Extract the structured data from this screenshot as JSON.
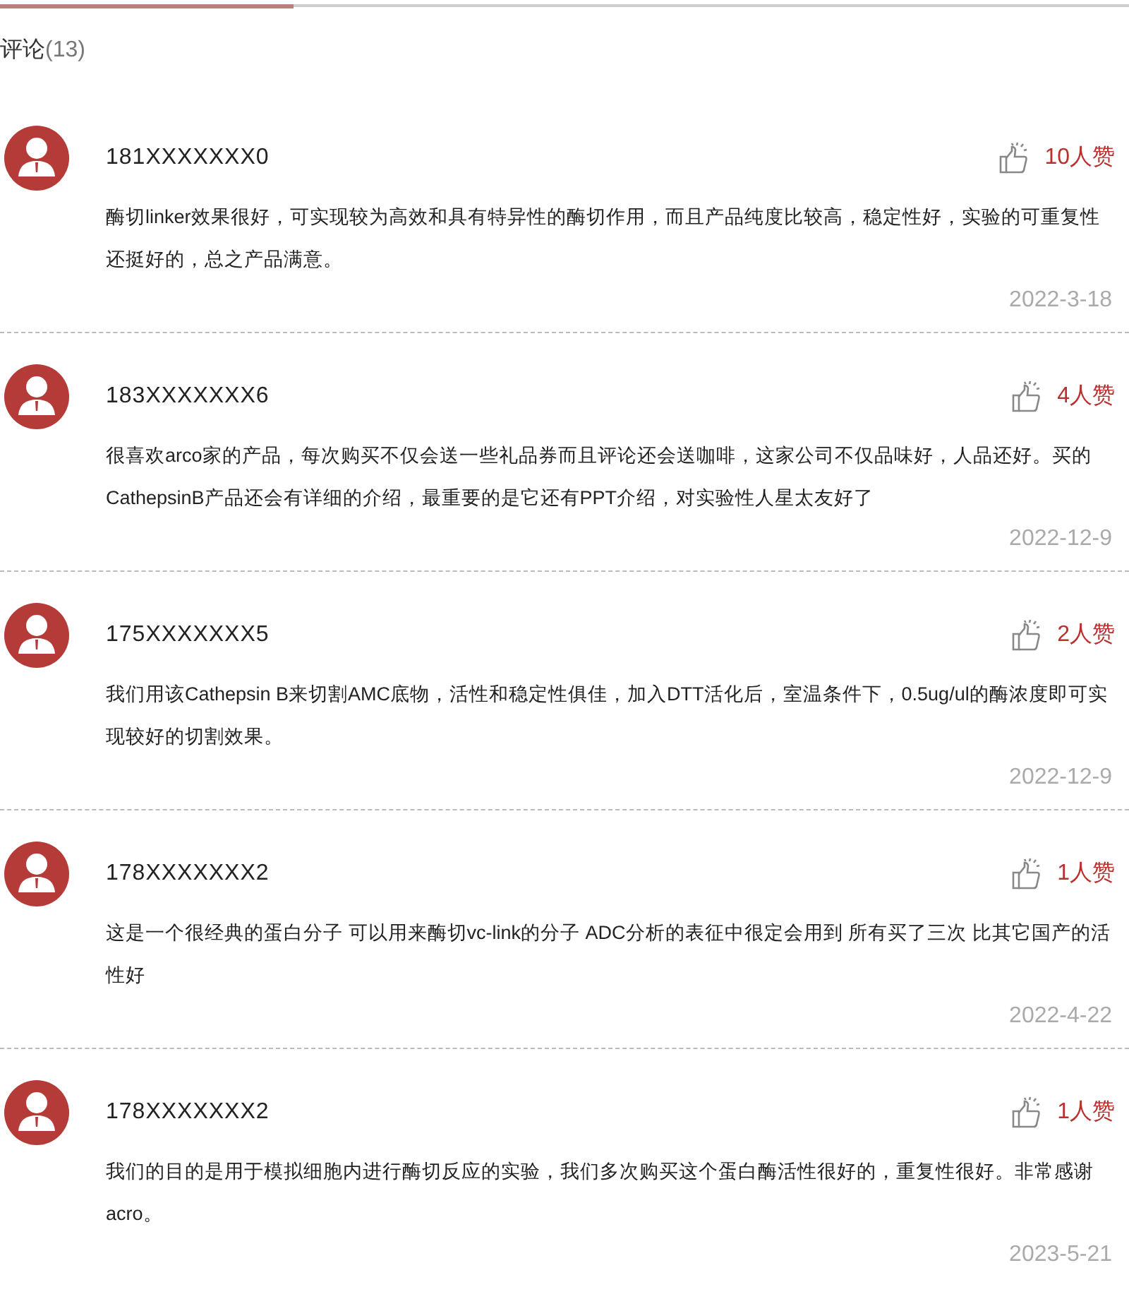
{
  "section_title": {
    "label": "评论",
    "count": "(13)"
  },
  "comments": [
    {
      "user": "181XXXXXXX0",
      "likes": "10人赞",
      "text": "酶切linker效果很好，可实现较为高效和具有特异性的酶切作用，而且产品纯度比较高，稳定性好，实验的可重复性还挺好的，总之产品满意。",
      "date": "2022-3-18"
    },
    {
      "user": "183XXXXXXX6",
      "likes": "4人赞",
      "text": "很喜欢arco家的产品，每次购买不仅会送一些礼品券而且评论还会送咖啡，这家公司不仅品味好，人品还好。买的CathepsinB产品还会有详细的介绍，最重要的是它还有PPT介绍，对实验性人星太友好了",
      "date": "2022-12-9"
    },
    {
      "user": "175XXXXXXX5",
      "likes": "2人赞",
      "text": "我们用该Cathepsin B来切割AMC底物，活性和稳定性俱佳，加入DTT活化后，室温条件下，0.5ug/ul的酶浓度即可实现较好的切割效果。",
      "date": "2022-12-9"
    },
    {
      "user": "178XXXXXXX2",
      "likes": "1人赞",
      "text": "这是一个很经典的蛋白分子 可以用来酶切vc-link的分子 ADC分析的表征中很定会用到 所有买了三次 比其它国产的活性好",
      "date": "2022-4-22"
    },
    {
      "user": "178XXXXXXX2",
      "likes": "1人赞",
      "text": "我们的目的是用于模拟细胞内进行酶切反应的实验，我们多次购买这个蛋白酶活性很好的，重复性很好。非常感谢acro。",
      "date": "2023-5-21"
    }
  ]
}
